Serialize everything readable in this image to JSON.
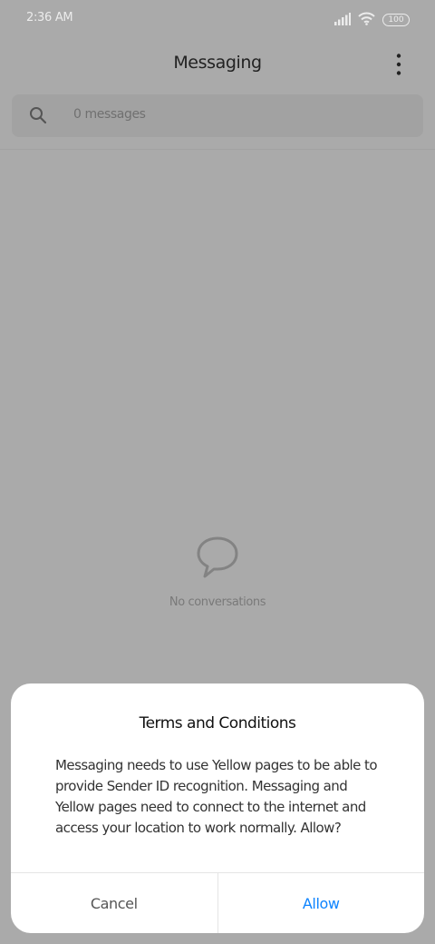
{
  "status_bar": {
    "time": "2:36 AM",
    "battery": "100",
    "icons": [
      "signal-icon",
      "wifi-icon",
      "battery-icon"
    ]
  },
  "header": {
    "title": "Messaging",
    "menu_icon": "more-vertical-icon"
  },
  "search": {
    "icon": "search-icon",
    "text": "0 messages"
  },
  "empty_state": {
    "icon": "chat-bubble-icon",
    "text": "No conversations"
  },
  "dialog": {
    "title": "Terms and Conditions",
    "body": "Messaging needs to use Yellow pages to be able to provide Sender ID recognition. Messaging and Yellow pages need to connect to the internet and access your location to work normally. Allow?",
    "cancel_label": "Cancel",
    "allow_label": "Allow"
  },
  "colors": {
    "scrim": "#aaaaaa",
    "accent": "#0d84ff"
  }
}
